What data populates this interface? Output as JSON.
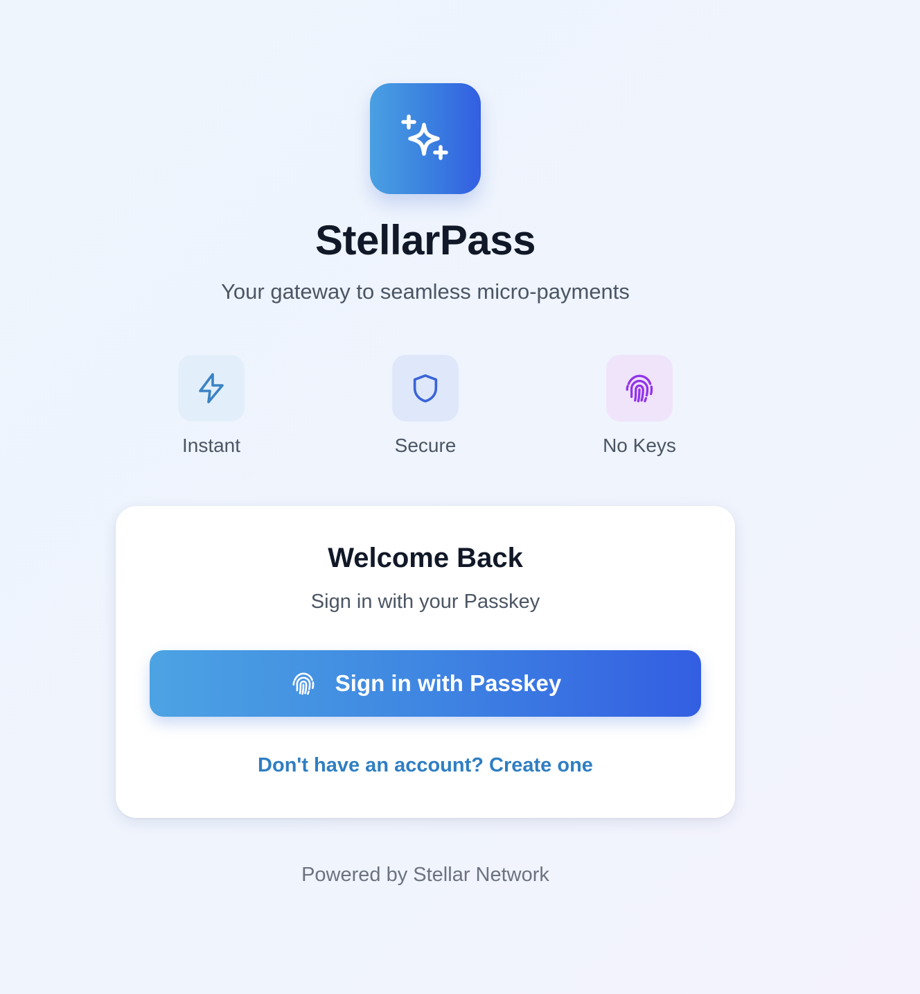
{
  "app": {
    "title": "StellarPass",
    "tagline": "Your gateway to seamless micro-payments",
    "logo_icon": "sparkles-icon"
  },
  "features": [
    {
      "label": "Instant",
      "icon": "lightning-bolt-icon",
      "color": "#3b82c4"
    },
    {
      "label": "Secure",
      "icon": "shield-icon",
      "color": "#3a64d8"
    },
    {
      "label": "No Keys",
      "icon": "fingerprint-icon",
      "color": "#9333ea"
    }
  ],
  "card": {
    "title": "Welcome Back",
    "subtitle": "Sign in with your Passkey",
    "signin_button": "Sign in with Passkey",
    "signin_icon": "fingerprint-icon",
    "signup_link": "Don't have an account? Create one"
  },
  "footer": {
    "text": "Powered by Stellar Network"
  },
  "colors": {
    "accent_start": "#4ca3e3",
    "accent_end": "#335ee2",
    "link": "#2f7ec2"
  }
}
